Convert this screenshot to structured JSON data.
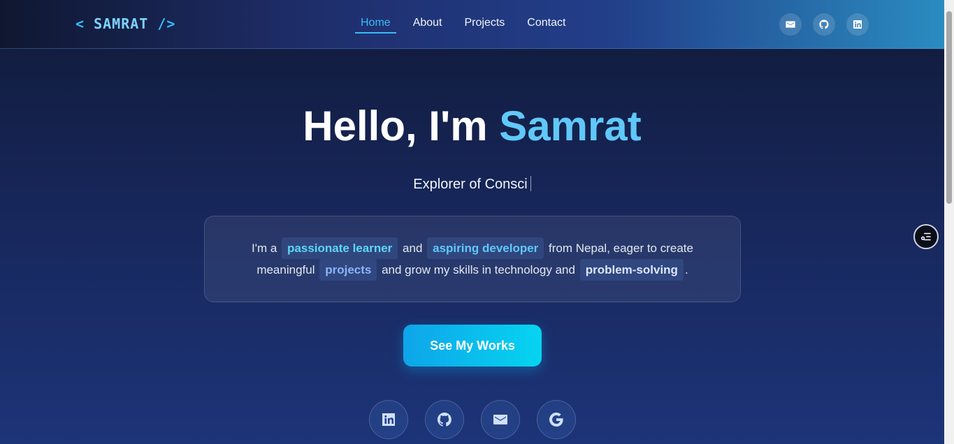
{
  "navbar": {
    "logo_prefix": "<",
    "logo_name": "SAMRAT",
    "logo_suffix": "/>",
    "links": [
      {
        "label": "Home",
        "active": true
      },
      {
        "label": "About",
        "active": false
      },
      {
        "label": "Projects",
        "active": false
      },
      {
        "label": "Contact",
        "active": false
      }
    ],
    "icons": [
      "mail-icon",
      "github-icon",
      "linkedin-icon"
    ]
  },
  "hero": {
    "greeting": "Hello, I'm",
    "name": "Samrat",
    "typed_text": "Explorer of Consci",
    "intro": {
      "t1": "I'm a",
      "chip1": "passionate learner",
      "t2": "and",
      "chip2": "aspiring developer",
      "t3": "from Nepal, eager to create meaningful",
      "chip3": "projects",
      "t4": "and grow my skills in technology and",
      "chip4": "problem-solving",
      "t5": "."
    },
    "cta_label": "See My Works"
  },
  "socials": [
    "linkedin-icon",
    "github-icon",
    "mail-icon",
    "google-icon"
  ],
  "colors": {
    "accent": "#38bdf8",
    "highlight": "#60c8f8",
    "background_top": "#101a38",
    "background_bottom": "#1c3478"
  }
}
